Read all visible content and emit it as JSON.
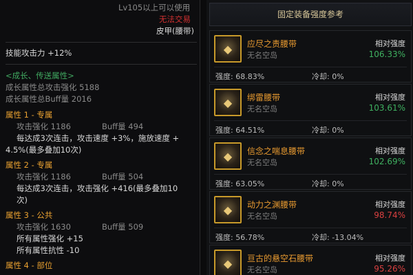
{
  "tooltip": {
    "level_req": "Lv105以上可以使用",
    "no_trade": "无法交易",
    "item_type": "皮甲(腰带)",
    "skill_attack": "技能攻击力  +12%",
    "growth_header": "<成长、传送属性>",
    "growth_attack": "成长属性总攻击强化 5188",
    "growth_buff": "成长属性总Buff量 2016",
    "attr1_title": "属性 1 - 专属",
    "attr1_attack": "攻击强化  1186",
    "attr1_buff": "Buff量  494",
    "attr1_desc1": "每达成3次连击，攻击速度 +3%，施放速度 +",
    "attr1_desc2": "4.5%(最多叠加10次)",
    "attr2_title": "属性 2 - 专属",
    "attr2_attack": "攻击强化  1186",
    "attr2_buff": "Buff量  504",
    "attr2_desc1": "每达成3次连击，攻击强化 +416(最多叠加10",
    "attr2_desc2": "次)",
    "attr3_title": "属性 3 - 公共",
    "attr3_attack": "攻击强化  1630",
    "attr3_buff": "Buff量  509",
    "attr3_desc1": "所有属性强化 +15",
    "attr3_desc2": "所有属性抗性 -10",
    "attr4_title": "属性 4 - 部位"
  },
  "panel": {
    "header": "固定装备强度参考",
    "rel_label": "相对强度",
    "items": [
      {
        "name": "应尽之责腰带",
        "source": "无名空岛",
        "relative": "106.33%",
        "rel_color": "#3fb060",
        "strength": "强度: 68.83%",
        "cooldown": "冷却: 0%"
      },
      {
        "name": "绑雷腰带",
        "source": "无名空岛",
        "relative": "103.61%",
        "rel_color": "#3fb060",
        "strength": "强度: 64.51%",
        "cooldown": "冷却: 0%"
      },
      {
        "name": "信念之喘息腰带",
        "source": "无名空岛",
        "relative": "102.69%",
        "rel_color": "#3fb060",
        "strength": "强度: 63.05%",
        "cooldown": "冷却: 0%"
      },
      {
        "name": "动力之渊腰带",
        "source": "无名空岛",
        "relative": "98.74%",
        "rel_color": "#d84040",
        "strength": "强度: 56.78%",
        "cooldown": "冷却: -13.04%"
      },
      {
        "name": "亘古的悬空石腰带",
        "source": "无名空岛",
        "relative": "95.26%",
        "rel_color": "#d84040",
        "strength": "",
        "cooldown": ""
      }
    ]
  }
}
